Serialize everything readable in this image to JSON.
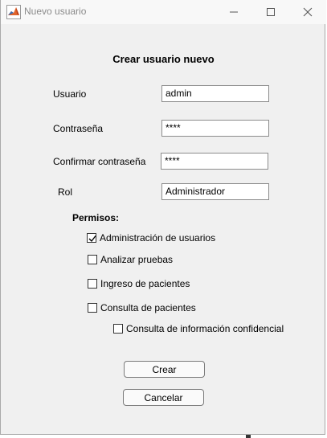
{
  "window": {
    "title": "Nuevo usuario",
    "controls": [
      "minimize-icon",
      "maximize-icon",
      "close-icon"
    ]
  },
  "form": {
    "title": "Crear usuario nuevo",
    "usuario_label": "Usuario",
    "usuario_value": "admin",
    "contrasena_label": "Contraseña",
    "contrasena_value": "****",
    "confirmar_label": "Confirmar contraseña",
    "confirmar_value": "****",
    "rol_label": "Rol",
    "rol_value": "Administrador",
    "permisos_label": "Permisos:"
  },
  "permissions": [
    {
      "label": "Administración de usuarios",
      "checked": true
    },
    {
      "label": "Analizar pruebas",
      "checked": false
    },
    {
      "label": "Ingreso de pacientes",
      "checked": false
    },
    {
      "label": "Consulta de pacientes",
      "checked": false
    },
    {
      "label": "Consulta de información confidencial",
      "checked": false
    }
  ],
  "buttons": {
    "crear": "Crear",
    "cancelar": "Cancelar"
  },
  "colors": {
    "window_bg": "#f0f0f0",
    "titlebar_bg": "#f8f8f8",
    "title_text": "#8a8a8a"
  }
}
